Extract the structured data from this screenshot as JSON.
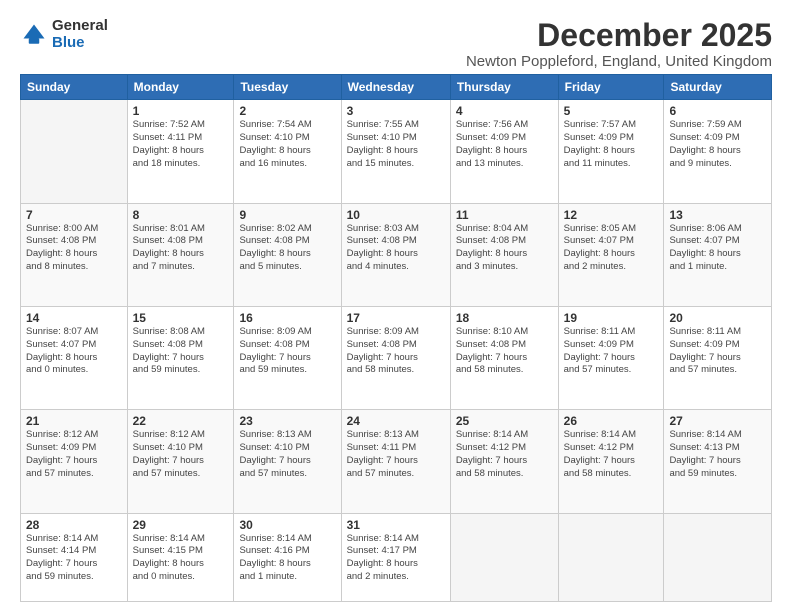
{
  "logo": {
    "general": "General",
    "blue": "Blue"
  },
  "title": "December 2025",
  "subtitle": "Newton Poppleford, England, United Kingdom",
  "weekdays": [
    "Sunday",
    "Monday",
    "Tuesday",
    "Wednesday",
    "Thursday",
    "Friday",
    "Saturday"
  ],
  "weeks": [
    [
      {
        "day": "",
        "info": ""
      },
      {
        "day": "1",
        "info": "Sunrise: 7:52 AM\nSunset: 4:11 PM\nDaylight: 8 hours\nand 18 minutes."
      },
      {
        "day": "2",
        "info": "Sunrise: 7:54 AM\nSunset: 4:10 PM\nDaylight: 8 hours\nand 16 minutes."
      },
      {
        "day": "3",
        "info": "Sunrise: 7:55 AM\nSunset: 4:10 PM\nDaylight: 8 hours\nand 15 minutes."
      },
      {
        "day": "4",
        "info": "Sunrise: 7:56 AM\nSunset: 4:09 PM\nDaylight: 8 hours\nand 13 minutes."
      },
      {
        "day": "5",
        "info": "Sunrise: 7:57 AM\nSunset: 4:09 PM\nDaylight: 8 hours\nand 11 minutes."
      },
      {
        "day": "6",
        "info": "Sunrise: 7:59 AM\nSunset: 4:09 PM\nDaylight: 8 hours\nand 9 minutes."
      }
    ],
    [
      {
        "day": "7",
        "info": "Sunrise: 8:00 AM\nSunset: 4:08 PM\nDaylight: 8 hours\nand 8 minutes."
      },
      {
        "day": "8",
        "info": "Sunrise: 8:01 AM\nSunset: 4:08 PM\nDaylight: 8 hours\nand 7 minutes."
      },
      {
        "day": "9",
        "info": "Sunrise: 8:02 AM\nSunset: 4:08 PM\nDaylight: 8 hours\nand 5 minutes."
      },
      {
        "day": "10",
        "info": "Sunrise: 8:03 AM\nSunset: 4:08 PM\nDaylight: 8 hours\nand 4 minutes."
      },
      {
        "day": "11",
        "info": "Sunrise: 8:04 AM\nSunset: 4:08 PM\nDaylight: 8 hours\nand 3 minutes."
      },
      {
        "day": "12",
        "info": "Sunrise: 8:05 AM\nSunset: 4:07 PM\nDaylight: 8 hours\nand 2 minutes."
      },
      {
        "day": "13",
        "info": "Sunrise: 8:06 AM\nSunset: 4:07 PM\nDaylight: 8 hours\nand 1 minute."
      }
    ],
    [
      {
        "day": "14",
        "info": "Sunrise: 8:07 AM\nSunset: 4:07 PM\nDaylight: 8 hours\nand 0 minutes."
      },
      {
        "day": "15",
        "info": "Sunrise: 8:08 AM\nSunset: 4:08 PM\nDaylight: 7 hours\nand 59 minutes."
      },
      {
        "day": "16",
        "info": "Sunrise: 8:09 AM\nSunset: 4:08 PM\nDaylight: 7 hours\nand 59 minutes."
      },
      {
        "day": "17",
        "info": "Sunrise: 8:09 AM\nSunset: 4:08 PM\nDaylight: 7 hours\nand 58 minutes."
      },
      {
        "day": "18",
        "info": "Sunrise: 8:10 AM\nSunset: 4:08 PM\nDaylight: 7 hours\nand 58 minutes."
      },
      {
        "day": "19",
        "info": "Sunrise: 8:11 AM\nSunset: 4:09 PM\nDaylight: 7 hours\nand 57 minutes."
      },
      {
        "day": "20",
        "info": "Sunrise: 8:11 AM\nSunset: 4:09 PM\nDaylight: 7 hours\nand 57 minutes."
      }
    ],
    [
      {
        "day": "21",
        "info": "Sunrise: 8:12 AM\nSunset: 4:09 PM\nDaylight: 7 hours\nand 57 minutes."
      },
      {
        "day": "22",
        "info": "Sunrise: 8:12 AM\nSunset: 4:10 PM\nDaylight: 7 hours\nand 57 minutes."
      },
      {
        "day": "23",
        "info": "Sunrise: 8:13 AM\nSunset: 4:10 PM\nDaylight: 7 hours\nand 57 minutes."
      },
      {
        "day": "24",
        "info": "Sunrise: 8:13 AM\nSunset: 4:11 PM\nDaylight: 7 hours\nand 57 minutes."
      },
      {
        "day": "25",
        "info": "Sunrise: 8:14 AM\nSunset: 4:12 PM\nDaylight: 7 hours\nand 58 minutes."
      },
      {
        "day": "26",
        "info": "Sunrise: 8:14 AM\nSunset: 4:12 PM\nDaylight: 7 hours\nand 58 minutes."
      },
      {
        "day": "27",
        "info": "Sunrise: 8:14 AM\nSunset: 4:13 PM\nDaylight: 7 hours\nand 59 minutes."
      }
    ],
    [
      {
        "day": "28",
        "info": "Sunrise: 8:14 AM\nSunset: 4:14 PM\nDaylight: 7 hours\nand 59 minutes."
      },
      {
        "day": "29",
        "info": "Sunrise: 8:14 AM\nSunset: 4:15 PM\nDaylight: 8 hours\nand 0 minutes."
      },
      {
        "day": "30",
        "info": "Sunrise: 8:14 AM\nSunset: 4:16 PM\nDaylight: 8 hours\nand 1 minute."
      },
      {
        "day": "31",
        "info": "Sunrise: 8:14 AM\nSunset: 4:17 PM\nDaylight: 8 hours\nand 2 minutes."
      },
      {
        "day": "",
        "info": ""
      },
      {
        "day": "",
        "info": ""
      },
      {
        "day": "",
        "info": ""
      }
    ]
  ]
}
